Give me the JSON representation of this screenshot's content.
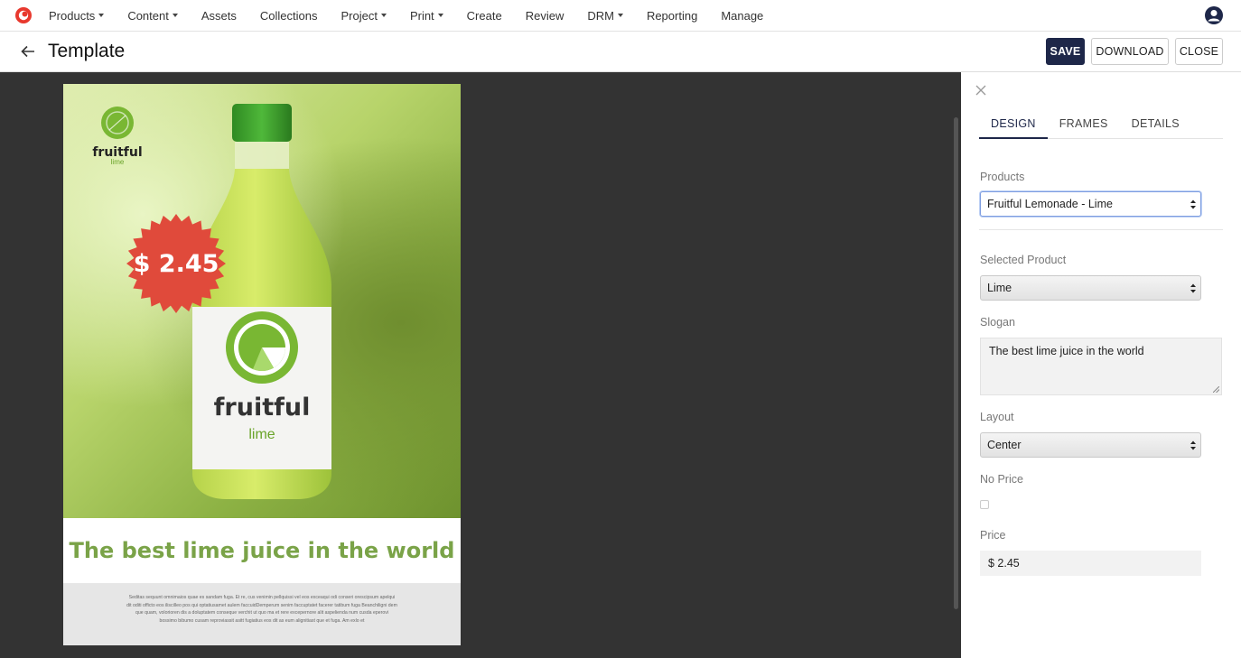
{
  "nav": {
    "items": [
      {
        "label": "Products",
        "dropdown": true
      },
      {
        "label": "Content",
        "dropdown": true
      },
      {
        "label": "Assets",
        "dropdown": false
      },
      {
        "label": "Collections",
        "dropdown": false
      },
      {
        "label": "Project",
        "dropdown": true
      },
      {
        "label": "Print",
        "dropdown": true
      },
      {
        "label": "Create",
        "dropdown": false
      },
      {
        "label": "Review",
        "dropdown": false
      },
      {
        "label": "DRM",
        "dropdown": true
      },
      {
        "label": "Reporting",
        "dropdown": false
      },
      {
        "label": "Manage",
        "dropdown": false
      }
    ]
  },
  "header": {
    "title": "Template",
    "save_label": "SAVE",
    "download_label": "DOWNLOAD",
    "close_label": "CLOSE"
  },
  "poster": {
    "brand_name": "fruitful",
    "brand_sub": "lime",
    "price_badge": "$ 2.45",
    "label_brand": "fruitful",
    "label_sub": "lime",
    "slogan": "The best lime juice in the world",
    "body_text": "Seditas sequunt omnimaios quae es sandam fuga. Et re, cus venimin pellquissi vel eos exceaqui odi conseri orescipsum apelqui dit oditi officto eos iliscilleo pos qui optatiusamet aulem faccuidDemperum senim faccuptatet facerer tatibum fuga Beanchiligni dem que quam, volorioren dis a doluptatem conseque verchit ut quo ma et rere excepernore alit aspelienda num cusda eperovi bossimo bibumo cusam reproviassit asitt fugiatius eos dit as eum alignitiast que et fuga. Am exlo et"
  },
  "panel": {
    "tabs": [
      "DESIGN",
      "FRAMES",
      "DETAILS"
    ],
    "active_tab": "DESIGN",
    "products_label": "Products",
    "products_value": "Fruitful Lemonade - Lime",
    "selected_product_label": "Selected Product",
    "selected_product_value": "Lime",
    "slogan_label": "Slogan",
    "slogan_value": "The best lime juice in the world",
    "layout_label": "Layout",
    "layout_value": "Center",
    "no_price_label": "No Price",
    "no_price_checked": false,
    "price_label": "Price",
    "price_value": "$ 2.45"
  },
  "colors": {
    "primary": "#1e2749",
    "canvas_bg": "#333333",
    "slogan_green": "#7aa348",
    "badge_red": "#e04a3b"
  }
}
